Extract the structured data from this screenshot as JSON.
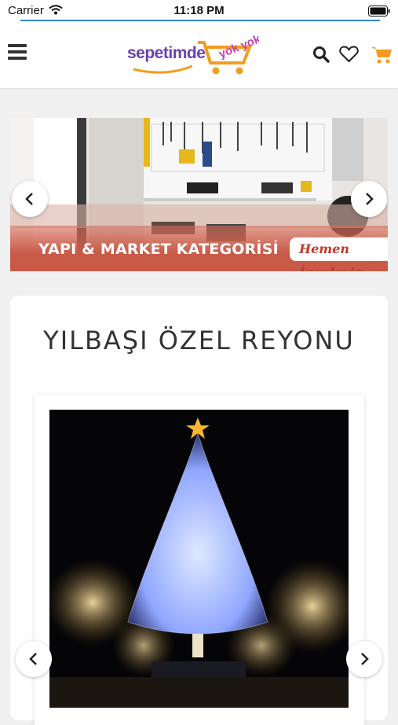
{
  "status_bar": {
    "carrier": "Carrier",
    "time": "11:18 PM"
  },
  "page_load_progress": 1.0,
  "header": {
    "logo_text": "sepetimde",
    "logo_tagline": "yok yok",
    "icons": [
      "menu-icon",
      "search-icon",
      "heart-icon",
      "cart-icon"
    ]
  },
  "banner": {
    "caption": "YAPI & MARKET KATEGORİSİ",
    "cta": "Hemen İnceleyin"
  },
  "section": {
    "title": "YILBAŞI ÖZEL REYONU"
  },
  "colors": {
    "accent_orange": "#f39c1f",
    "brand_purple": "#6b3fb0",
    "progress_blue": "#2f86d6"
  }
}
